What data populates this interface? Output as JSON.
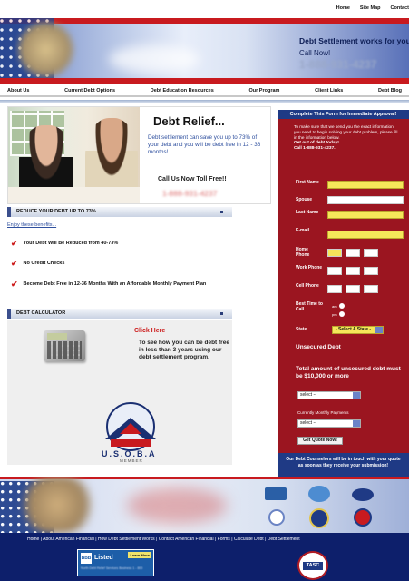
{
  "top_links": [
    "Home",
    "Site Map",
    "Contact"
  ],
  "header": {
    "tagline": "Debt Settlement works for you",
    "call_now": "Call Now!",
    "phone": "1-888-931-4237"
  },
  "nav": [
    "About Us",
    "Current Debt Options",
    "Debt Education Resources",
    "Our Program",
    "Client Links",
    "Debt Blog"
  ],
  "hero": {
    "title": "Debt Relief...",
    "text": "Debt settlement can save you up to 73% of your debt and you will be debt free in 12 - 36 months!",
    "call_label": "Call Us Now Toll Free!!",
    "phone": "1-888-931-4237"
  },
  "reduce_section": {
    "title": "REDUCE YOUR DEBT UP TO 73%",
    "enjoy": "Enjoy these benefits...",
    "benefits": [
      "Your Debt Will Be Reduced from 40-73%",
      "No Credit Checks",
      "Become Debt Free in 12-36 Months With an Affordable Monthly Payment Plan"
    ]
  },
  "calculator_section": {
    "title": "DEBT CALCULATOR",
    "click_here": "Click Here",
    "text": "To see how you can be debt free in less than 3 years using our debt settlement program."
  },
  "usoba": {
    "label": "U.S.O.B.A",
    "member": "MEMBER"
  },
  "form": {
    "header": "Complete This Form for Immediate Approval!",
    "intro": "To make sure that we send you the exact information you need to begin solving your debt problem, please fill in the information below.",
    "get_out": "Get out of debt today!",
    "call": "Call 1-888-931-4237.",
    "labels": {
      "first_name": "First Name",
      "spouse": "Spouse",
      "last_name": "Last Name",
      "email": "E-mail",
      "home_phone": "Home Phone",
      "work_phone": "Work Phone",
      "cell_phone": "Cell Phone",
      "best_time": "Best Time to Call",
      "state": "State"
    },
    "am": "am",
    "pm": "pm",
    "state_select": "- Select A State -",
    "unsecured_debt": "Unsecured Debt",
    "total_label": "Total amount of unsecured debt must be $10,000 or more",
    "select_placeholder": "select --",
    "monthly_label": "Currently Monthly Payments",
    "select_placeholder2": "select --",
    "quote_button": "Get Quote Now!",
    "footer": "Our Debt Counselors will be in touch with your quote as soon as they receive your submission!"
  },
  "footer": {
    "links": "Home | About American Financial | How Debt Settlement Works | Contact American Financial | Forms | Calculate Debt | Debt Settlement",
    "bbb_accredited": "Listed",
    "bbb_learn": "Learn More",
    "bbb_small": "North Debt Relief Services Business 1 - 800",
    "tasc": "TASC"
  },
  "colors": {
    "form_red": "#9b1520",
    "navy": "#1f3a85",
    "input_yellow": "#f5e65a",
    "link_blue": "#2e4f9e",
    "check_red": "#cc1c1c"
  }
}
